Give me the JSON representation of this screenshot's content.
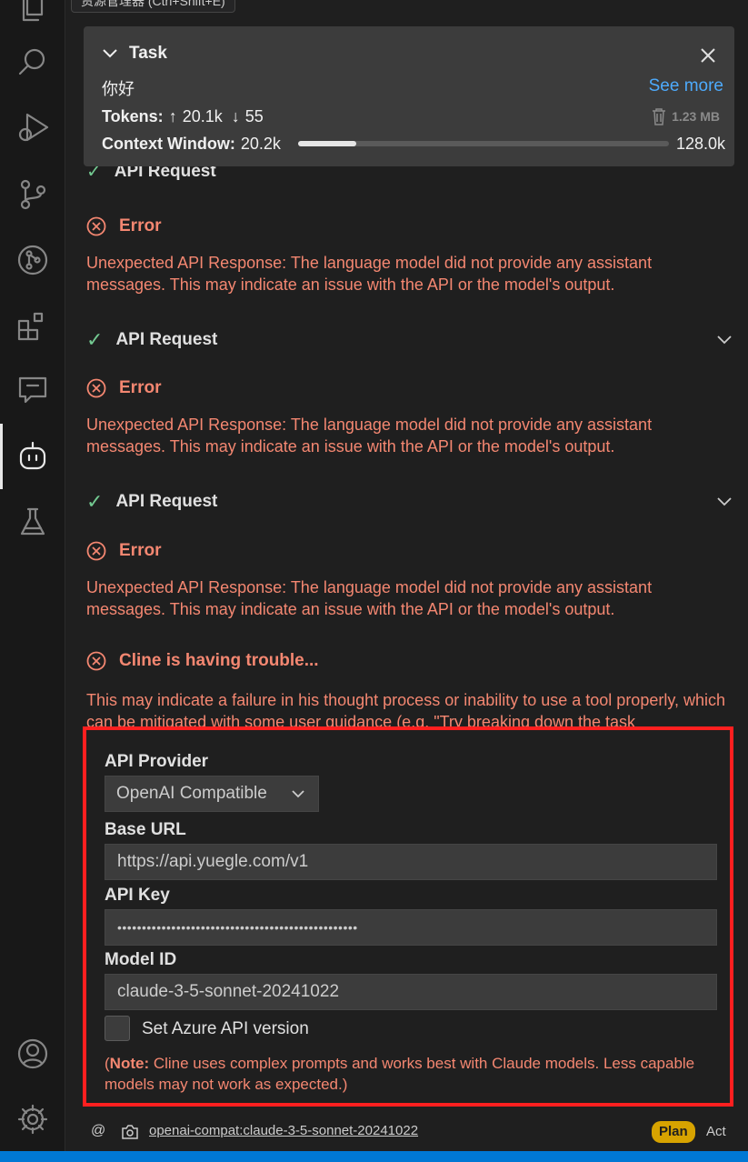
{
  "tooltip": "资源管理器 (Ctrl+Shift+E)",
  "task": {
    "title": "Task",
    "text": "你好",
    "see_more": "See more",
    "tokens_label": "Tokens:",
    "tokens_in": "20.1k",
    "tokens_out": "55",
    "size": "1.23 MB",
    "context_label": "Context Window:",
    "context_used": "20.2k",
    "context_max": "128.0k",
    "context_fraction": 0.158
  },
  "messages": {
    "partial_api": "API Request",
    "error_label": "Error",
    "error_text": "Unexpected API Response: The language model did not provide any assistant messages. This may indicate an issue with the API or the model's output.",
    "api_request": "API Request",
    "trouble_title": "Cline is having trouble...",
    "trouble_text": "This may indicate a failure in his thought process or inability to use a tool properly, which can be mitigated with some user guidance (e.g. \"Try breaking down the task"
  },
  "settings": {
    "provider_label": "API Provider",
    "provider_value": "OpenAI Compatible",
    "base_url_label": "Base URL",
    "base_url_value": "https://api.yuegle.com/v1",
    "api_key_label": "API Key",
    "api_key_value": "•••••••••••••••••••••••••••••••••••••••••••••••••",
    "model_id_label": "Model ID",
    "model_id_value": "claude-3-5-sonnet-20241022",
    "azure_label": "Set Azure API version",
    "note_prefix": "Note:",
    "note_text": " Cline uses complex prompts and works best with Claude models. Less capable models may not work as expected.)"
  },
  "footer": {
    "at_symbol": "@",
    "model_link": "openai-compat:claude-3-5-sonnet-20241022",
    "plan": "Plan",
    "act": "Act"
  },
  "colors": {
    "error": "#f48771",
    "ok": "#73c991",
    "accent": "#4daafc",
    "highlight_border": "#ff1f1f",
    "plan_badge": "#d7a300"
  }
}
